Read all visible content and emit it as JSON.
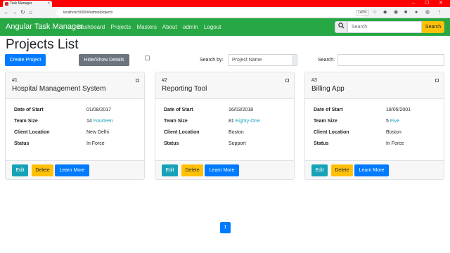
{
  "browser": {
    "tab_title": "Task Manager",
    "url": "localhost:5000/#/admin/projects",
    "zoom": "140%",
    "tab_close": "×",
    "win_controls": "– ☐ ✕"
  },
  "navbar": {
    "brand": "Angular Task Manager",
    "links": [
      "Dashboard",
      "Projects",
      "Masters",
      "About",
      "admin",
      "Logout"
    ],
    "search_placeholder": "Search",
    "search_button": "Search"
  },
  "page": {
    "title": "Projects List",
    "create_button": "Create Project",
    "toggle_button": "Hide/Show Details",
    "search_by_label": "Search by:",
    "search_by_value": "Project Name",
    "search_label": "Search:"
  },
  "field_labels": {
    "date_of_start": "Date of Start",
    "team_size": "Team Size",
    "client_location": "Client Location",
    "status": "Status"
  },
  "card_buttons": {
    "edit": "Edit",
    "delete": "Delete",
    "learn_more": "Learn More"
  },
  "projects": [
    {
      "num": "#1",
      "name": "Hospital Management System",
      "date_of_start": "01/08/2017",
      "team_size": "14",
      "team_size_words": "Fourteen",
      "client_location": "New Delhi",
      "status": "In Force"
    },
    {
      "num": "#2",
      "name": "Reporting Tool",
      "date_of_start": "16/03/2018",
      "team_size": "81",
      "team_size_words": "Eighty-One",
      "client_location": "Boston",
      "status": "Support"
    },
    {
      "num": "#3",
      "name": "Billing App",
      "date_of_start": "18/05/2001",
      "team_size": "5",
      "team_size_words": "Five",
      "client_location": "Boston",
      "status": "In Force"
    }
  ],
  "pagination": {
    "current": "1"
  },
  "colors": {
    "navbar": "#28a745",
    "primary": "#007bff",
    "warning": "#ffc107",
    "info": "#17a2b8",
    "secondary": "#6c757d",
    "tabbar": "#ff0000"
  },
  "icons": {
    "search": "search-icon",
    "back": "arrow-left-icon",
    "forward": "arrow-right-icon",
    "reload": "reload-icon",
    "home": "home-icon"
  }
}
